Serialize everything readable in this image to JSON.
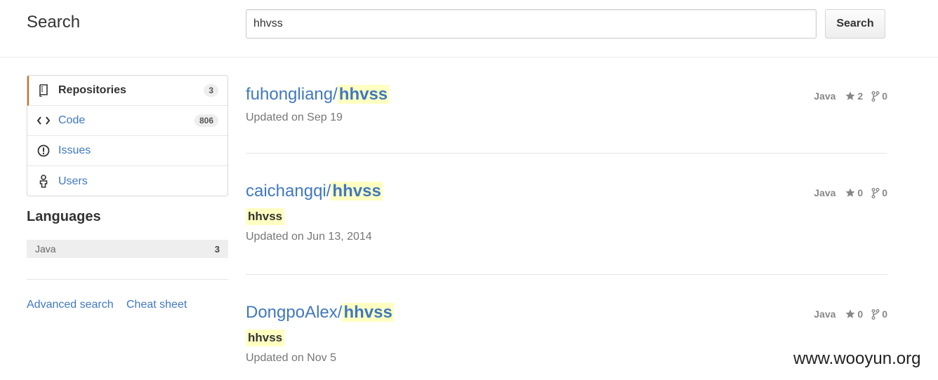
{
  "header": {
    "title": "Search",
    "search_value": "hhvss",
    "search_button": "Search"
  },
  "sidebar": {
    "items": [
      {
        "label": "Repositories",
        "count": "3",
        "icon": "repo-icon",
        "selected": true
      },
      {
        "label": "Code",
        "count": "806",
        "icon": "code-icon"
      },
      {
        "label": "Issues",
        "icon": "issue-icon"
      },
      {
        "label": "Users",
        "icon": "person-icon"
      }
    ],
    "languages_title": "Languages",
    "languages": [
      {
        "name": "Java",
        "count": "3"
      }
    ],
    "links": {
      "advanced_search": "Advanced search",
      "cheat_sheet": "Cheat sheet"
    }
  },
  "results": [
    {
      "owner": "fuhongliang/",
      "name": "hhvss",
      "description": "",
      "updated": "Updated on Sep 19",
      "language": "Java",
      "stars": "2",
      "forks": "0"
    },
    {
      "owner": "caichangqi/",
      "name": "hhvss",
      "description": "hhvss",
      "updated": "Updated on Jun 13, 2014",
      "language": "Java",
      "stars": "0",
      "forks": "0"
    },
    {
      "owner": "DongpoAlex/",
      "name": "hhvss",
      "description": "hhvss",
      "updated": "Updated on Nov 5",
      "language": "Java",
      "stars": "0",
      "forks": "0"
    }
  ],
  "watermark": "www.wooyun.org",
  "colors": {
    "link": "#4078c0",
    "highlight": "#ffffc1",
    "selected_accent": "#d26911"
  }
}
